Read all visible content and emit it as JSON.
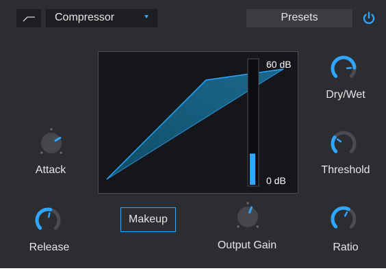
{
  "header": {
    "mode_icon": "curve-icon",
    "effect_name": "Compressor",
    "presets_label": "Presets",
    "power_icon": "power-icon"
  },
  "graph": {
    "top_db_label": "60 dB",
    "bottom_db_label": "0 dB",
    "meter_level": 0.25
  },
  "knobs": {
    "attack": {
      "label": "Attack",
      "value": 0.72
    },
    "release": {
      "label": "Release",
      "value": 0.55
    },
    "output_gain": {
      "label": "Output Gain",
      "value": 0.58
    },
    "dry_wet": {
      "label": "Dry/Wet",
      "value": 0.82
    },
    "threshold": {
      "label": "Threshold",
      "value": 0.3
    },
    "ratio": {
      "label": "Ratio",
      "value": 0.6
    }
  },
  "buttons": {
    "makeup_label": "Makeup"
  },
  "colors": {
    "accent": "#2fa6ff",
    "panel": "#2b2d31",
    "graph_bg": "#15161a"
  }
}
